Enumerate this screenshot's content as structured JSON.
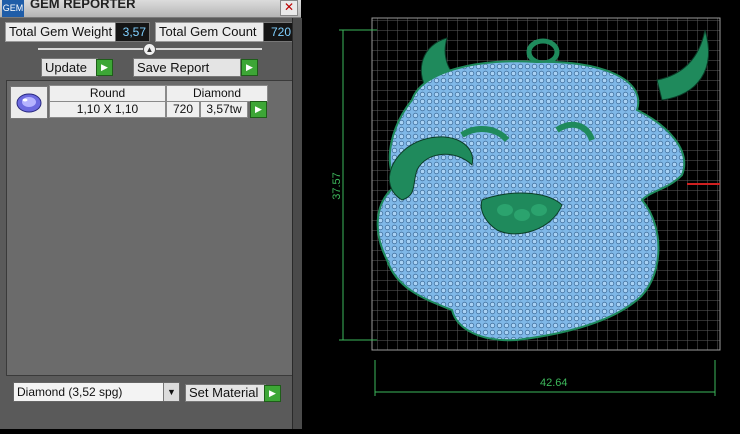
{
  "title": "GEM REPORTER",
  "app_icon_label": "GEM",
  "close_label": "✕",
  "stats": {
    "weight_label": "Total Gem Weight",
    "weight_value": "3,57",
    "count_label": "Total Gem Count",
    "count_value": "720"
  },
  "buttons": {
    "update": "Update",
    "save_report": "Save Report",
    "set_material": "Set Material"
  },
  "table": {
    "headers": [
      "Round",
      "Diamond"
    ],
    "row": {
      "size": "1,10 X 1,10",
      "count": "720",
      "weight": "3,57tw"
    }
  },
  "material_select": {
    "value": "Diamond    (3,52 spg)"
  },
  "viewport": {
    "dim_width": "42.64",
    "dim_height": "37.57",
    "gem_color": "#7fb8e8",
    "metal_color": "#1f8a5c",
    "dim_color": "#3db85b"
  }
}
